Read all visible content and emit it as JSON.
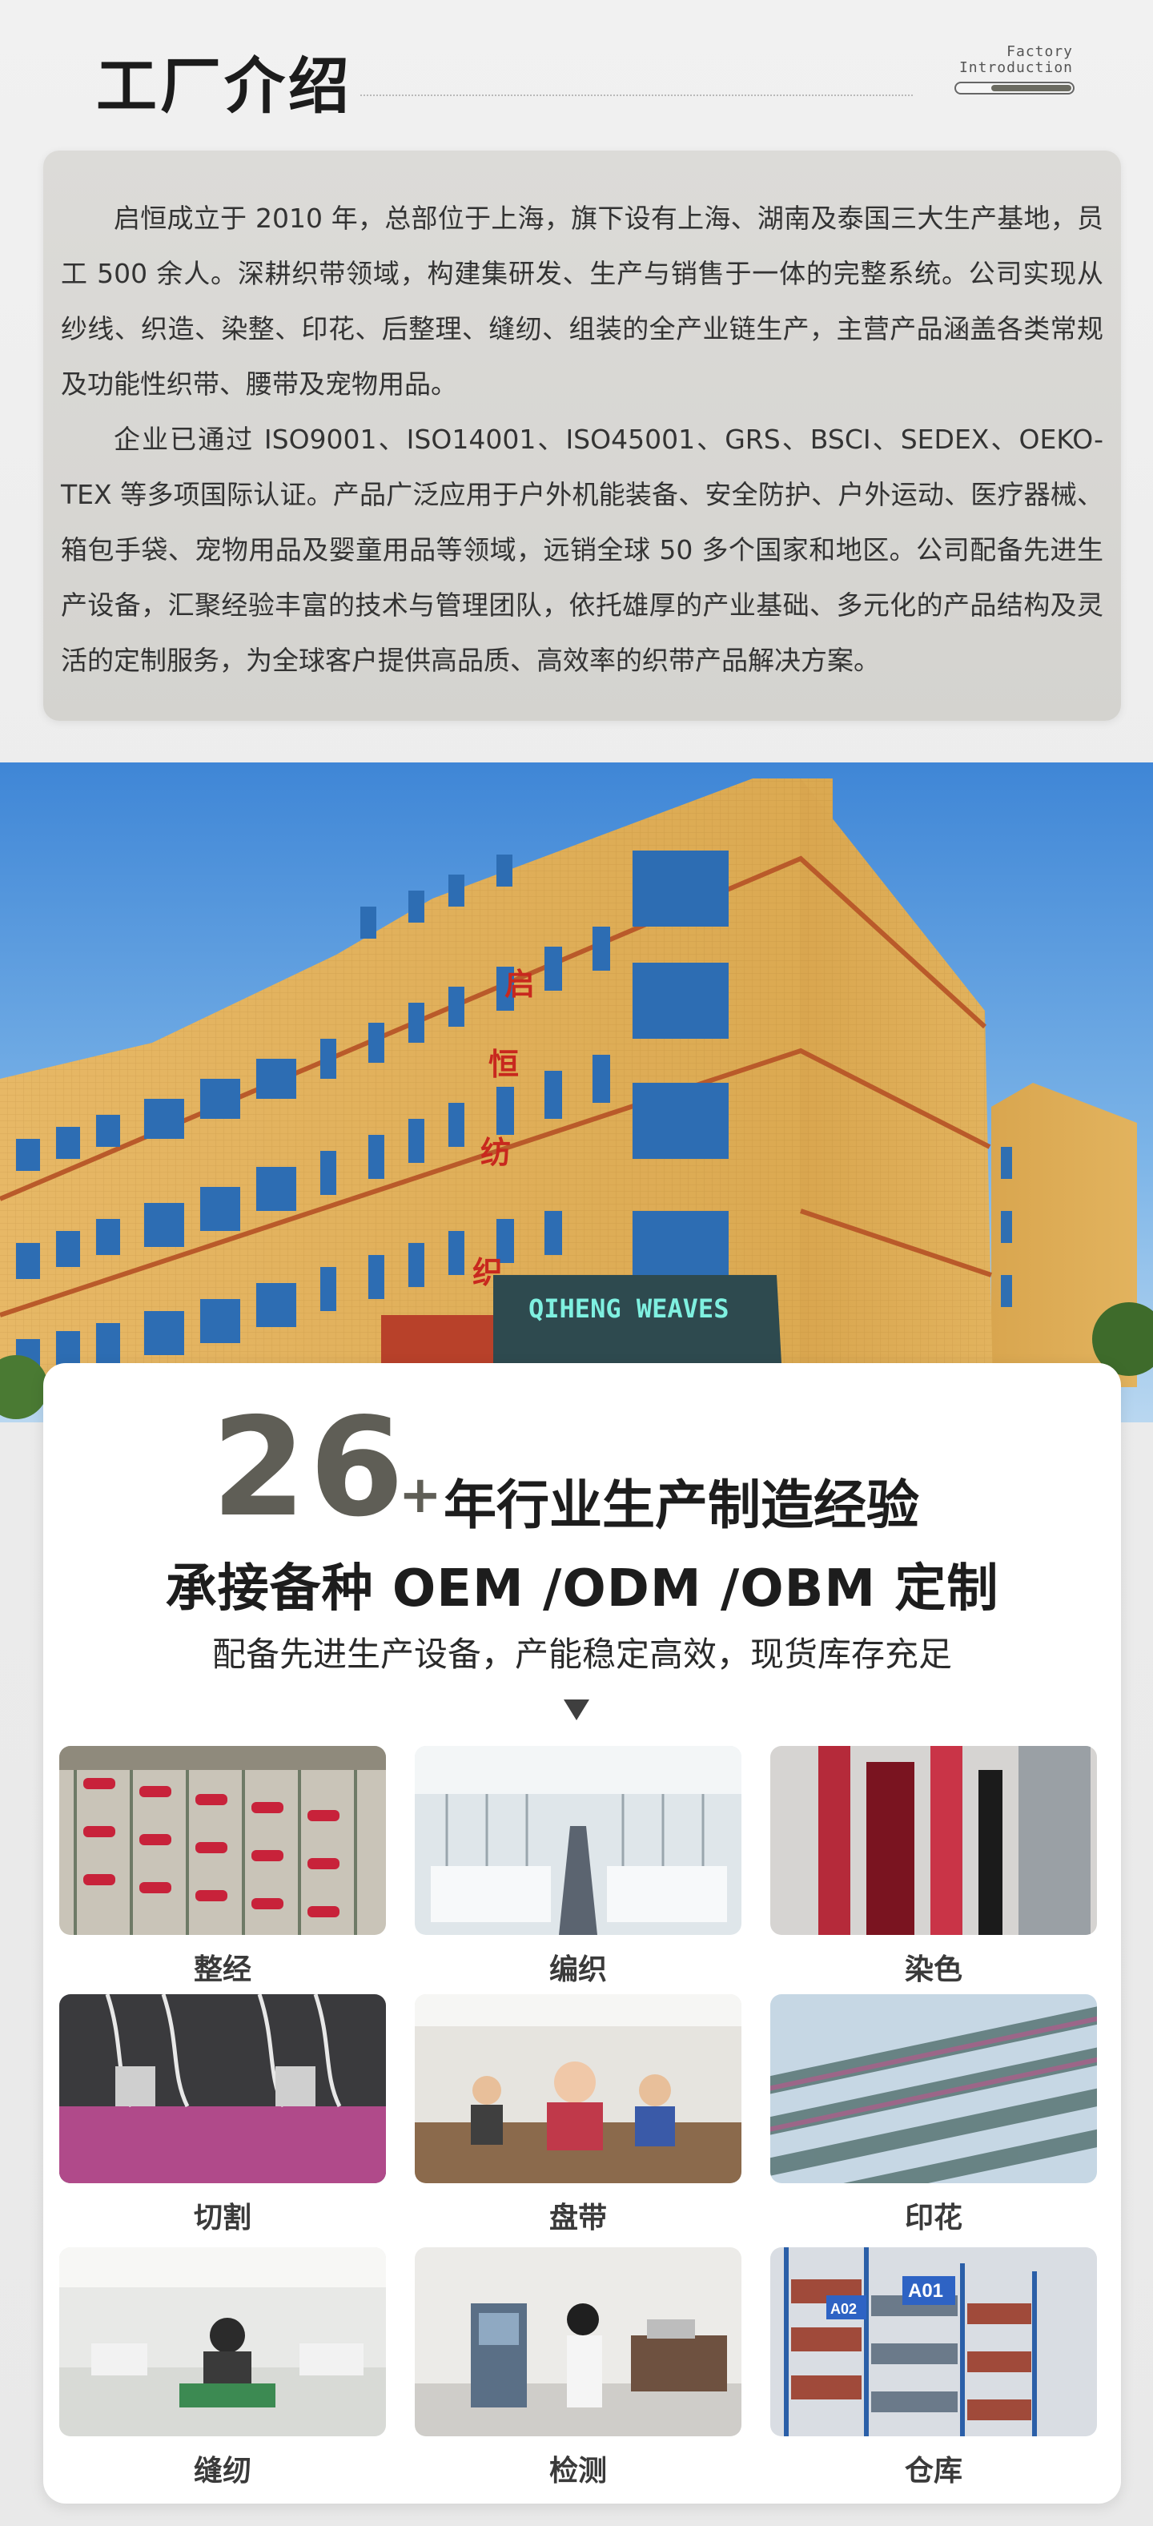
{
  "header": {
    "title": "工厂介绍",
    "badge_line1": "Factory",
    "badge_line2": "Introduction"
  },
  "intro": {
    "paragraph1": "启恒成立于 2010 年，总部位于上海，旗下设有上海、湖南及泰国三大生产基地，员工 500 余人。深耕织带领域，构建集研发、生产与销售于一体的完整系统。公司实现从纱线、织造、染整、印花、后整理、缝纫、组装的全产业链生产，主营产品涵盖各类常规及功能性织带、腰带及宠物用品。",
    "paragraph2": "企业已通过 ISO9001、ISO14001、ISO45001、GRS、BSCI、SEDEX、OEKO-TEX 等多项国际认证。产品广泛应用于户外机能装备、安全防护、户外运动、医疗器械、箱包手袋、宠物用品及婴童用品等领域，远销全球 50 多个国家和地区。公司配备先进生产设备，汇聚经验丰富的技术与管理团队，依托雄厚的产业基础、多元化的产品结构及灵活的定制服务，为全球客户提供高品质、高效率的织带产品解决方案。"
  },
  "building": {
    "facade_chars": [
      "启",
      "恒",
      "纺",
      "织"
    ],
    "sign_text": "QIHENG WEAVES"
  },
  "experience": {
    "years": "26",
    "plus": "+",
    "line1": "年行业生产制造经验",
    "line2": "承接备种 OEM /ODM /OBM 定制",
    "line3": "配备先进生产设备，产能稳定高效，现货库存充足"
  },
  "processes": [
    {
      "label": "整经",
      "icon": "warping-photo"
    },
    {
      "label": "编织",
      "icon": "weaving-photo"
    },
    {
      "label": "染色",
      "icon": "dyeing-photo"
    },
    {
      "label": "切割",
      "icon": "cutting-photo"
    },
    {
      "label": "盘带",
      "icon": "reeling-photo"
    },
    {
      "label": "印花",
      "icon": "printing-photo"
    },
    {
      "label": "缝纫",
      "icon": "sewing-photo"
    },
    {
      "label": "检测",
      "icon": "testing-photo"
    },
    {
      "label": "仓库",
      "icon": "warehouse-photo"
    }
  ],
  "warehouse_tags": [
    "A02",
    "A01"
  ],
  "colors": {
    "accent_grey": "#5f5e56",
    "card_bg": "#d8d7d3",
    "building_wall": "#e3b25c",
    "sign_text": "#7ff0e0"
  }
}
